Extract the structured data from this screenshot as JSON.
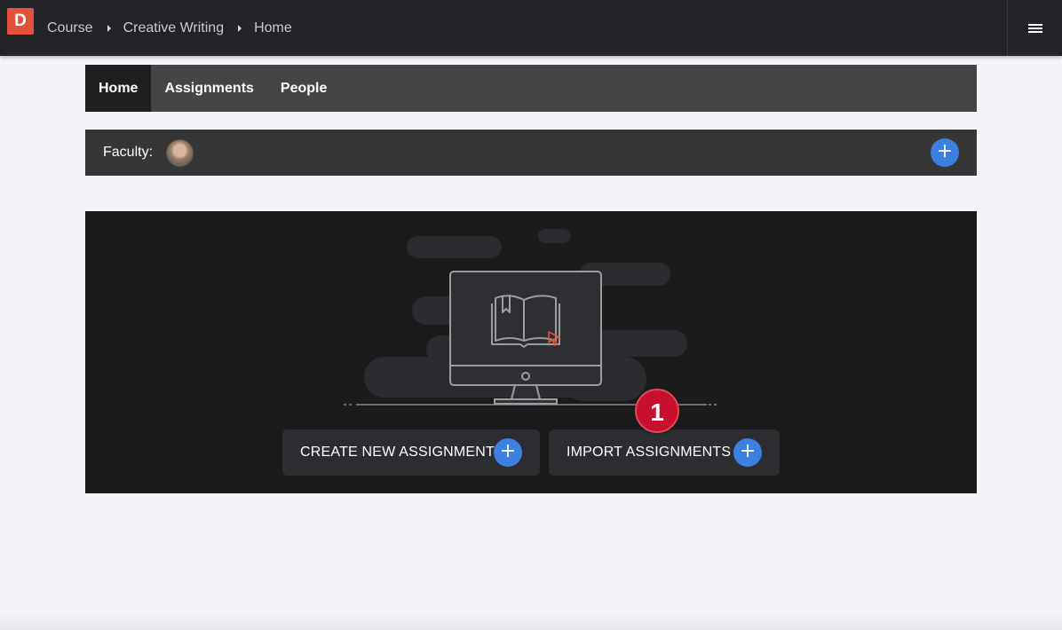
{
  "app": {
    "logo_letter": "D",
    "brand_color": "#e2523b",
    "menu_icon": "hamburger-icon"
  },
  "breadcrumb": [
    "Course",
    "Creative Writing",
    "Home"
  ],
  "tabs": [
    {
      "label": "Home",
      "active": true
    },
    {
      "label": "Assignments",
      "active": false
    },
    {
      "label": "People",
      "active": false
    }
  ],
  "faculty": {
    "label": "Faculty:",
    "add_icon": "plus-icon"
  },
  "hero": {
    "illustration": "computer-with-book-icon",
    "create_label": "CREATE NEW ASSIGNMENT",
    "import_label": "IMPORT ASSIGNMENTS",
    "plus_symbol": "+"
  },
  "annotation": {
    "badge_number": "1",
    "badge_color": "#c8102e"
  },
  "colors": {
    "accent_blue": "#3b7fe0",
    "topbar": "#232427"
  }
}
